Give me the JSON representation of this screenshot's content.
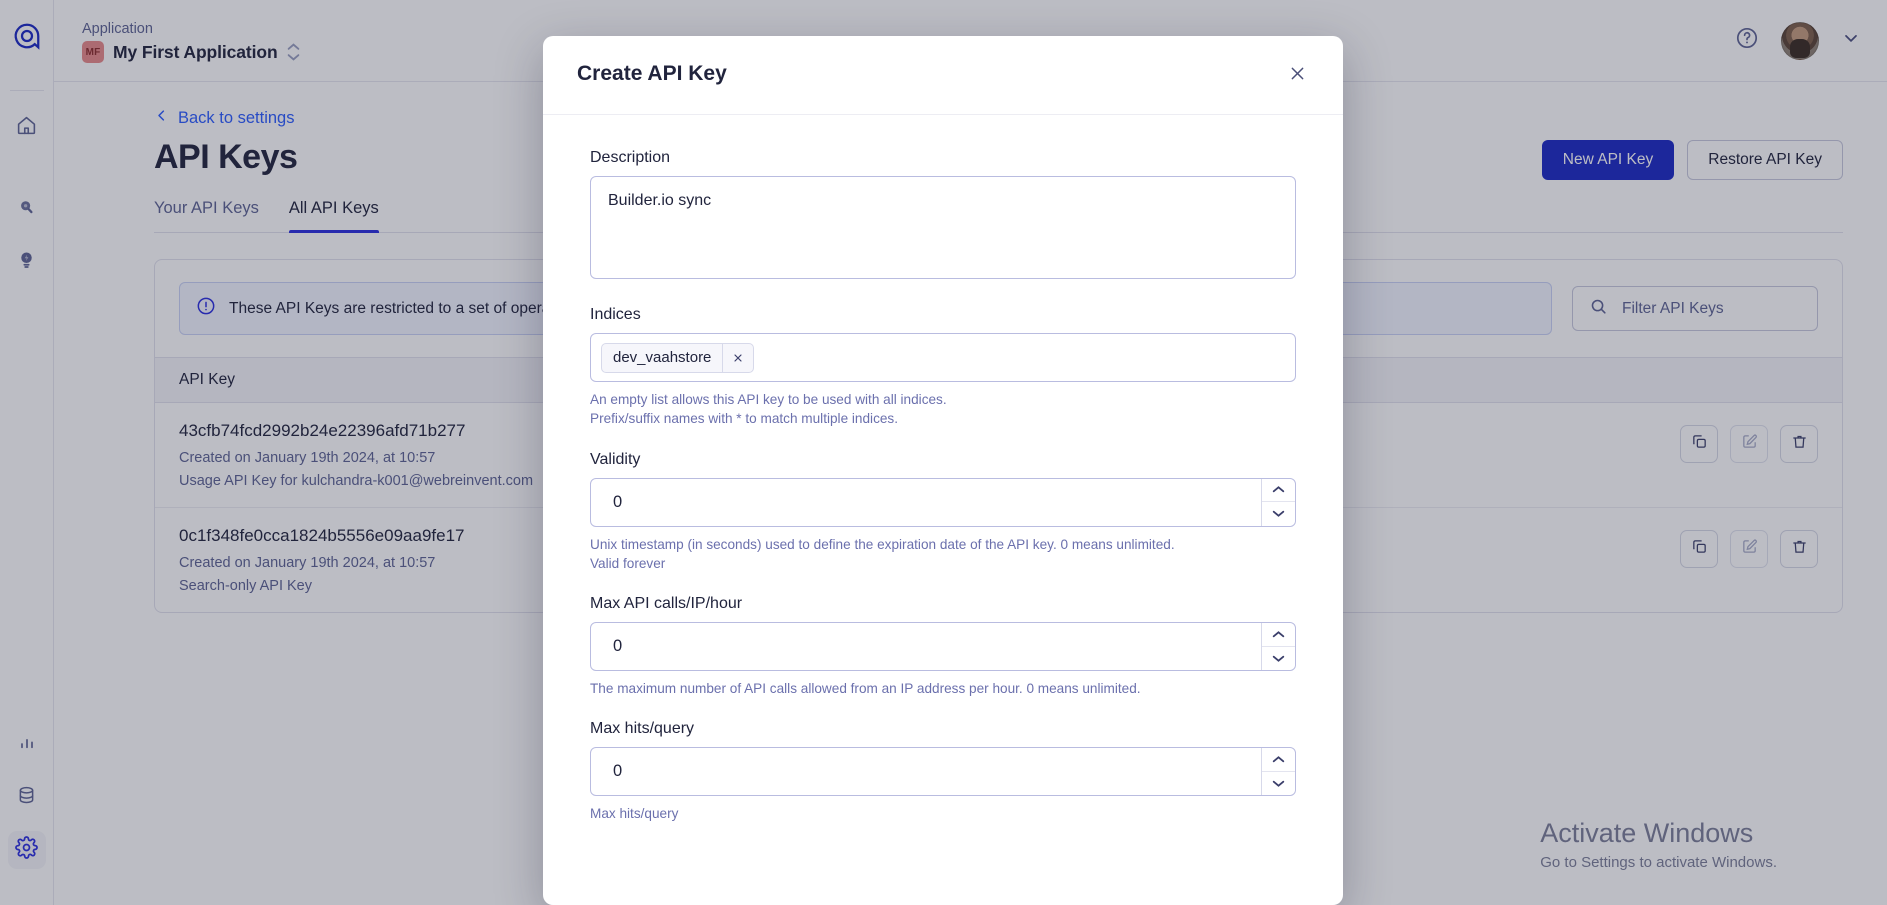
{
  "sidebar": {
    "logo_icon": "algolia-logo-icon",
    "items": [
      {
        "name": "home",
        "icon": "home-icon",
        "active": false
      },
      {
        "name": "search",
        "icon": "search-pin-icon",
        "active": false
      },
      {
        "name": "insights",
        "icon": "lightbulb-bolt-icon",
        "active": false
      }
    ],
    "bottom_items": [
      {
        "name": "analytics",
        "icon": "bar-chart-icon",
        "active": false
      },
      {
        "name": "data-sources",
        "icon": "database-icon",
        "active": false
      },
      {
        "name": "settings",
        "icon": "gear-icon",
        "active": true
      }
    ]
  },
  "topbar": {
    "application_label": "Application",
    "application_badge": "MF",
    "application_name": "My First Application",
    "help_icon": "question-circle-icon",
    "avatar_icon": "user-avatar",
    "caret_icon": "chevron-down-icon"
  },
  "page": {
    "back_link": "Back to settings",
    "back_icon": "chevron-left-icon",
    "title": "API Keys",
    "tabs": [
      {
        "label": "Your API Keys",
        "active": false
      },
      {
        "label": "All API Keys",
        "active": true
      }
    ],
    "primary_button": "New API Key",
    "secondary_button": "Restore API Key",
    "alert": {
      "icon": "info-circle-icon",
      "text": "These API Keys are restricted to a set of operati"
    },
    "filter": {
      "icon": "search-icon",
      "placeholder": "Filter API Keys"
    },
    "table": {
      "column_header": "API Key",
      "rows": [
        {
          "key": "43cfb74fcd2992b24e22396afd71b277",
          "created": "Created on January 19th 2024, at 10:57",
          "description": "Usage API Key for kulchandra-k001@webreinvent.com",
          "actions": [
            {
              "name": "copy-key-button",
              "icon": "copy-icon"
            },
            {
              "name": "edit-key-button",
              "icon": "edit-pencil-icon"
            },
            {
              "name": "delete-key-button",
              "icon": "trash-icon"
            }
          ]
        },
        {
          "key": "0c1f348fe0cca1824b5556e09aa9fe17",
          "created": "Created on January 19th 2024, at 10:57",
          "description": "Search-only API Key",
          "actions": [
            {
              "name": "copy-key-button",
              "icon": "copy-icon"
            },
            {
              "name": "edit-key-button",
              "icon": "edit-pencil-icon"
            },
            {
              "name": "delete-key-button",
              "icon": "trash-icon"
            }
          ]
        }
      ]
    },
    "watermark_line1": "Activate Windows",
    "watermark_line2": "Go to Settings to activate Windows."
  },
  "modal": {
    "title": "Create API Key",
    "close_icon": "close-icon",
    "description": {
      "label": "Description",
      "value": "Builder.io sync"
    },
    "indices": {
      "label": "Indices",
      "tags": [
        "dev_vaahstore"
      ],
      "tag_remove_icon": "close-icon",
      "help_line1": "An empty list allows this API key to be used with all indices.",
      "help_line2": "Prefix/suffix names with * to match multiple indices."
    },
    "validity": {
      "label": "Validity",
      "value": "0",
      "help_line1": "Unix timestamp (in seconds) used to define the expiration date of the API key. 0 means unlimited.",
      "help_line2": "Valid forever"
    },
    "max_api_calls": {
      "label": "Max API calls/IP/hour",
      "value": "0",
      "help_line1": "The maximum number of API calls allowed from an IP address per hour. 0 means unlimited."
    },
    "max_hits": {
      "label": "Max hits/query",
      "value": "0",
      "help_line1": "Max hits/query"
    },
    "spinner_up_icon": "chevron-up-icon",
    "spinner_down_icon": "chevron-down-icon"
  },
  "colors": {
    "brand_blue": "#2b2fe0",
    "primary_button": "#1b29c4",
    "link_blue": "#2b5cff",
    "text_dark": "#21243d",
    "text_muted": "#5d6494",
    "help_text": "#6b70ad"
  }
}
